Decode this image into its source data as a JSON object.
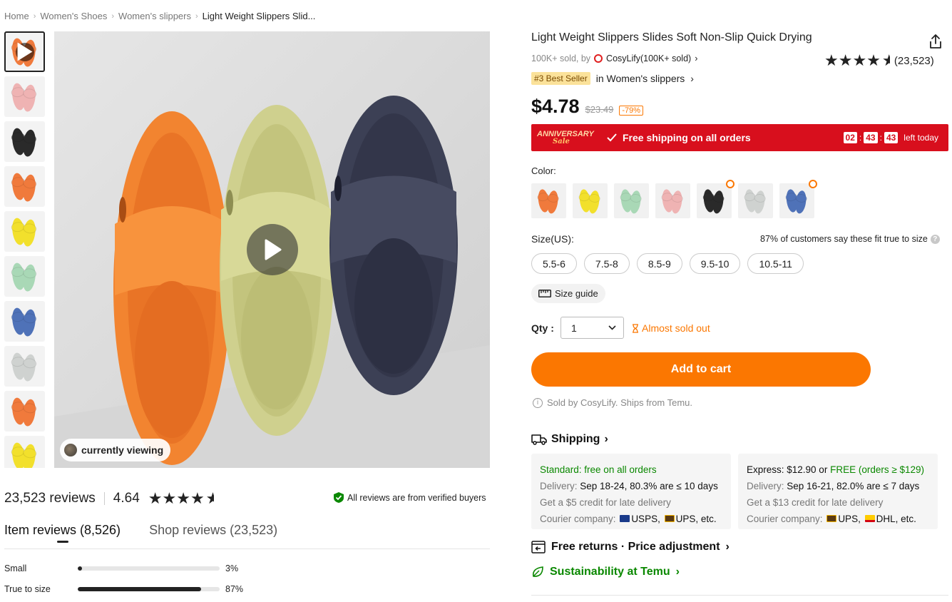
{
  "breadcrumb": {
    "items": [
      "Home",
      "Women's Shoes",
      "Women's slippers"
    ],
    "current": "Light Weight Slippers Slid..."
  },
  "product": {
    "title": "Light Weight Slippers Slides Soft Non-Slip Quick Drying",
    "sold_text": "100K+ sold, by",
    "store_name": "CosyLify(100K+ sold)",
    "rating_count": "(23,523)",
    "bestseller_badge": "#3 Best Seller",
    "bestseller_category": "in Women's slippers",
    "price": "$4.78",
    "original_price": "$23.49",
    "discount": "-79%"
  },
  "promo": {
    "event_line1": "ANNIVERSARY",
    "event_line2": "Sale",
    "shipping_text": "Free shipping on all orders",
    "timer": [
      "02",
      "43",
      "43"
    ],
    "left_text": "left today",
    "colors": {
      "banner": "#d80f1d",
      "accent": "#fb7701"
    }
  },
  "options": {
    "color_label": "Color:",
    "colors": [
      {
        "name": "orange",
        "hex": "#f07a3c",
        "hot": false
      },
      {
        "name": "yellow",
        "hex": "#f2e02c",
        "hot": false
      },
      {
        "name": "mint",
        "hex": "#a9d8b6",
        "hot": false
      },
      {
        "name": "pink",
        "hex": "#efb3b3",
        "hot": false
      },
      {
        "name": "black",
        "hex": "#2a2a2a",
        "hot": true
      },
      {
        "name": "grey",
        "hex": "#cfd2d0",
        "hot": false
      },
      {
        "name": "blue",
        "hex": "#4f72b8",
        "hot": true
      }
    ],
    "size_label": "Size(US):",
    "fit_note": "87% of customers say these fit true to size",
    "sizes": [
      "5.5-6",
      "7.5-8",
      "8.5-9",
      "9.5-10",
      "10.5-11"
    ],
    "size_guide": "Size guide",
    "qty_label": "Qty :",
    "qty_value": "1",
    "stock_note": "Almost sold out"
  },
  "actions": {
    "add_to_cart": "Add to cart",
    "sold_by": "Sold by CosyLify. Ships from Temu."
  },
  "shipping": {
    "heading": "Shipping",
    "standard": {
      "title": "Standard: free on all orders",
      "delivery_label": "Delivery:",
      "delivery_value": "Sep 18-24, 80.3% are ≤ 10 days",
      "credit": "Get a $5 credit for late delivery",
      "courier_label": "Courier company:",
      "courier_value_1": "USPS,",
      "courier_value_2": "UPS, etc."
    },
    "express": {
      "title_prefix": "Express: $12.90 or",
      "title_free": "FREE (orders ≥ $129)",
      "delivery_label": "Delivery:",
      "delivery_value": "Sep 16-21, 82.0% are ≤ 7 days",
      "credit": "Get a $13 credit for late delivery",
      "courier_label": "Courier company:",
      "courier_value_1": "UPS,",
      "courier_value_2": "DHL, etc."
    },
    "returns": "Free returns · Price adjustment",
    "sustainability": "Sustainability at Temu"
  },
  "media": {
    "viewing_label": "currently viewing",
    "thumb_colors": [
      "#f07a3c",
      "#efb3b3",
      "#2a2a2a",
      "#f07a3c",
      "#f2e02c",
      "#a9d8b6",
      "#4f72b8",
      "#cfd2d0",
      "#f07a3c",
      "#f2e02c"
    ]
  },
  "reviews": {
    "count_text": "23,523 reviews",
    "average": "4.64",
    "verified_text": "All reviews are from verified buyers",
    "tabs": [
      {
        "label": "Item reviews (8,526)",
        "active": true
      },
      {
        "label": "Shop reviews (23,523)",
        "active": false
      }
    ],
    "fit": [
      {
        "label": "Small",
        "percent": 3,
        "display": "3%"
      },
      {
        "label": "True to size",
        "percent": 87,
        "display": "87%"
      }
    ]
  }
}
